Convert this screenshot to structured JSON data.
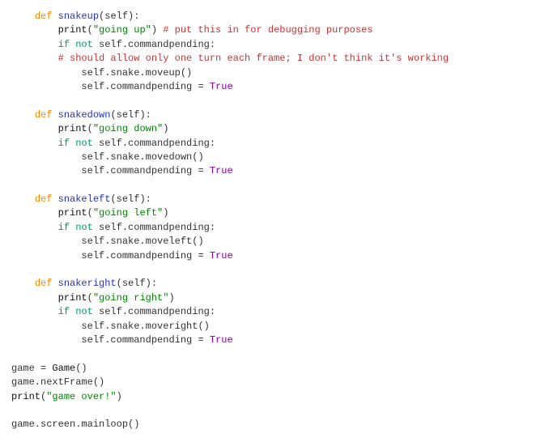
{
  "indent1": "    ",
  "indent2": "        ",
  "indent3": "            ",
  "kw": {
    "def": "def",
    "ifnot": "if not",
    "true_": "True"
  },
  "common": {
    "self": "self",
    "print": "print",
    "self_commandpending": "self.commandpending",
    "assign_eq": " = ",
    "colon": ":",
    "open_paren": "(",
    "close_paren": ")",
    "open_sig": "(self):"
  },
  "snakeup": {
    "name": "snakeup",
    "print_arg": "\"going up\"",
    "trail_comment": " # put this in for debugging purposes",
    "block_comment": "# should allow only one turn each frame; I don't think it's working",
    "move_call": "self.snake.moveup()"
  },
  "snakedown": {
    "name": "snakedown",
    "print_arg": "\"going down\"",
    "move_call": "self.snake.movedown()"
  },
  "snakeleft": {
    "name": "snakeleft",
    "print_arg": "\"going left\"",
    "move_call": "self.snake.moveleft()"
  },
  "snakeright": {
    "name": "snakeright",
    "print_arg": "\"going right\"",
    "move_call": "self.snake.moveright()"
  },
  "tail": {
    "l1a": "game = ",
    "l1b": "Game",
    "l1c": "()",
    "l2": "game.nextFrame()",
    "l3_call": "print",
    "l3_arg": "\"game over!\"",
    "l4": "game.screen.mainloop()"
  }
}
